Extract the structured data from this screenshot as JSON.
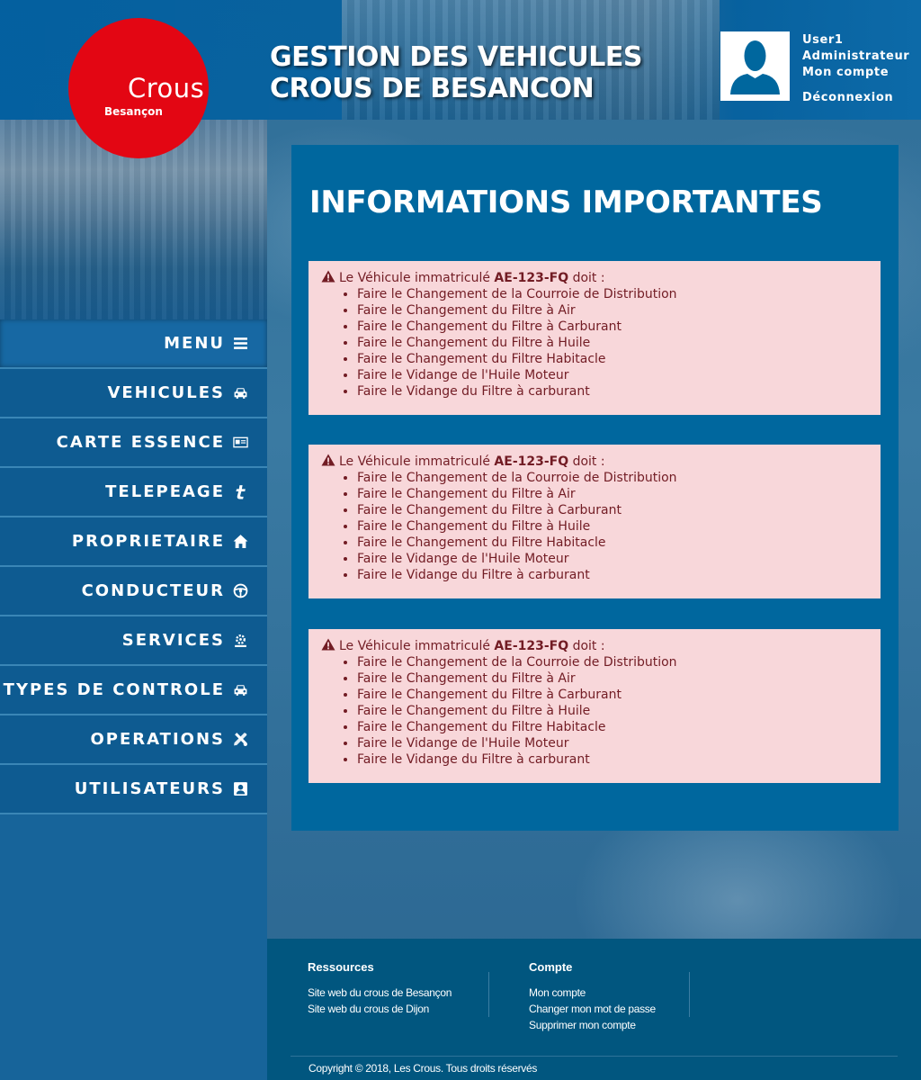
{
  "header": {
    "logo_name": "Crous",
    "logo_city": "Besançon",
    "title_line1": "GESTION DES VEHICULES",
    "title_line2": "CROUS DE BESANCON",
    "user": {
      "name": "User1",
      "role": "Administrateur",
      "account_link": "Mon compte",
      "logout_link": "Déconnexion"
    }
  },
  "sidebar": {
    "items": [
      {
        "label": "MENU",
        "icon": "menu-icon"
      },
      {
        "label": "VEHICULES",
        "icon": "car-icon"
      },
      {
        "label": "CARTE ESSENCE",
        "icon": "card-icon"
      },
      {
        "label": "TELEPEAGE",
        "icon": "toll-icon"
      },
      {
        "label": "PROPRIETAIRE",
        "icon": "home-icon"
      },
      {
        "label": "CONDUCTEUR",
        "icon": "steering-wheel-icon"
      },
      {
        "label": "SERVICES",
        "icon": "services-gear-icon"
      },
      {
        "label": "TYPES DE CONTROLE",
        "icon": "car-icon"
      },
      {
        "label": "OPERATIONS",
        "icon": "tools-icon"
      },
      {
        "label": "UTILISATEURS",
        "icon": "user-card-icon"
      }
    ]
  },
  "main": {
    "title": "INFORMATIONS IMPORTANTES",
    "alerts": [
      {
        "prefix": "Le Véhicule immatriculé",
        "plate": "AE-123-FQ",
        "suffix": "doit :",
        "tasks": [
          "Faire le Changement de la Courroie de Distribution",
          "Faire le Changement du Filtre à Air",
          "Faire le Changement du Filtre à Carburant",
          "Faire le Changement du Filtre à Huile",
          "Faire le Changement du Filtre Habitacle",
          "Faire le Vidange de l'Huile Moteur",
          "Faire le Vidange du Filtre à carburant"
        ]
      },
      {
        "prefix": "Le Véhicule immatriculé",
        "plate": "AE-123-FQ",
        "suffix": "doit :",
        "tasks": [
          "Faire le Changement de la Courroie de Distribution",
          "Faire le Changement du Filtre à Air",
          "Faire le Changement du Filtre à Carburant",
          "Faire le Changement du Filtre à Huile",
          "Faire le Changement du Filtre Habitacle",
          "Faire le Vidange de l'Huile Moteur",
          "Faire le Vidange du Filtre à carburant"
        ]
      },
      {
        "prefix": "Le Véhicule immatriculé",
        "plate": "AE-123-FQ",
        "suffix": "doit :",
        "tasks": [
          "Faire le Changement de la Courroie de Distribution",
          "Faire le Changement du Filtre à Air",
          "Faire le Changement du Filtre à Carburant",
          "Faire le Changement du Filtre à Huile",
          "Faire le Changement du Filtre Habitacle",
          "Faire le Vidange de l'Huile Moteur",
          "Faire le Vidange du Filtre à carburant"
        ]
      }
    ]
  },
  "footer": {
    "resources_title": "Ressources",
    "resources_links": [
      "Site web du crous de Besançon",
      "Site web du crous de Dijon"
    ],
    "account_title": "Compte",
    "account_links": [
      "Mon compte",
      "Changer mon mot de passe",
      "Supprimer mon compte"
    ],
    "copyright": "Copyright © 2018, Les Crous. Tous droits réservés"
  },
  "colors": {
    "brand_red": "#e30613",
    "brand_blue": "#00679e",
    "alert_bg": "#f8d7da",
    "alert_text": "#721c24"
  }
}
